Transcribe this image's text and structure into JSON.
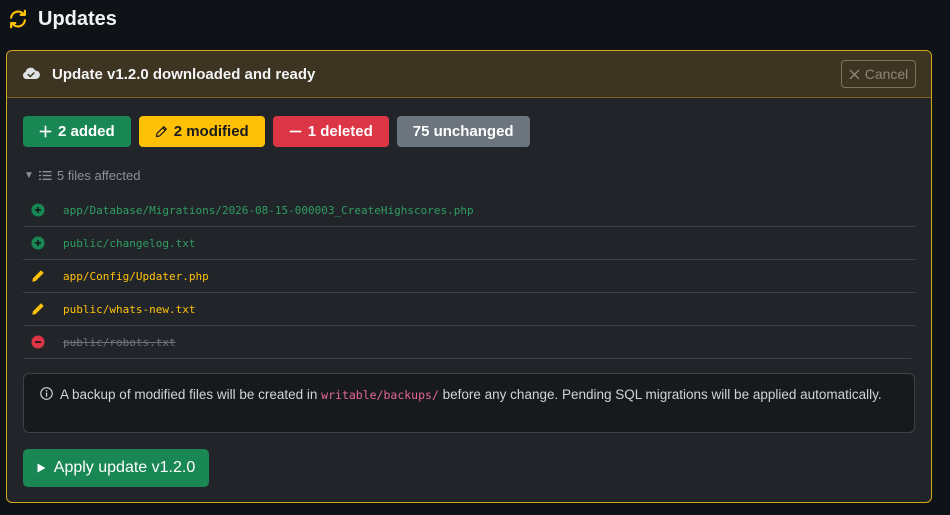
{
  "page": {
    "title": "Updates"
  },
  "card": {
    "title": "Update v1.2.0 downloaded and ready",
    "cancel_label": "Cancel"
  },
  "badges": {
    "added": "2 added",
    "modified": "2 modified",
    "deleted": "1 deleted",
    "unchanged": "75 unchanged"
  },
  "files": {
    "summary": "5 files affected",
    "items": [
      {
        "status": "added",
        "path": "app/Database/Migrations/2026-08-15-000003_CreateHighscores.php"
      },
      {
        "status": "added",
        "path": "public/changelog.txt"
      },
      {
        "status": "modified",
        "path": "app/Config/Updater.php"
      },
      {
        "status": "modified",
        "path": "public/whats-new.txt"
      },
      {
        "status": "deleted",
        "path": "public/robots.txt"
      }
    ]
  },
  "info": {
    "text_before": "A backup of modified files will be created in",
    "code": "writable/backups/",
    "text_after": "before any change. Pending SQL migrations will be applied automatically."
  },
  "apply_label": "Apply update v1.2.0",
  "colors": {
    "accent": "#ffc107",
    "added": "#198754",
    "modified": "#ffc107",
    "deleted": "#dc3545",
    "unchanged": "#6c757d"
  }
}
